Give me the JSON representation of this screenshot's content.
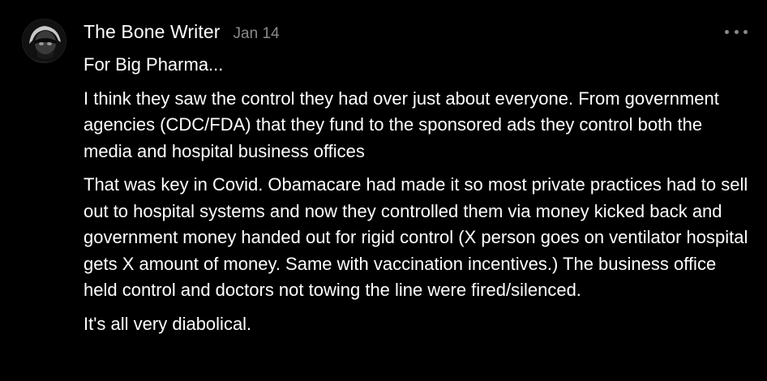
{
  "comment": {
    "author": "The Bone Writer",
    "date": "Jan 14",
    "paragraphs": [
      "For Big Pharma...",
      "I think they saw the control they had over just about everyone. From government agencies (CDC/FDA) that they fund to the sponsored ads they control both the media and hospital business offices",
      "That was key in Covid. Obamacare had made it so most private practices had to sell out to hospital systems and now they controlled them via money kicked back and government money handed out for rigid control (X person goes on ventilator hospital gets X amount of money. Same with vaccination incentives.) The business office held control and doctors not towing the line were fired/silenced.",
      "It's all very diabolical."
    ]
  },
  "icons": {
    "more": "more-horizontal-icon"
  },
  "colors": {
    "background": "#000000",
    "text": "#ffffff",
    "muted": "#8a8a8a"
  }
}
